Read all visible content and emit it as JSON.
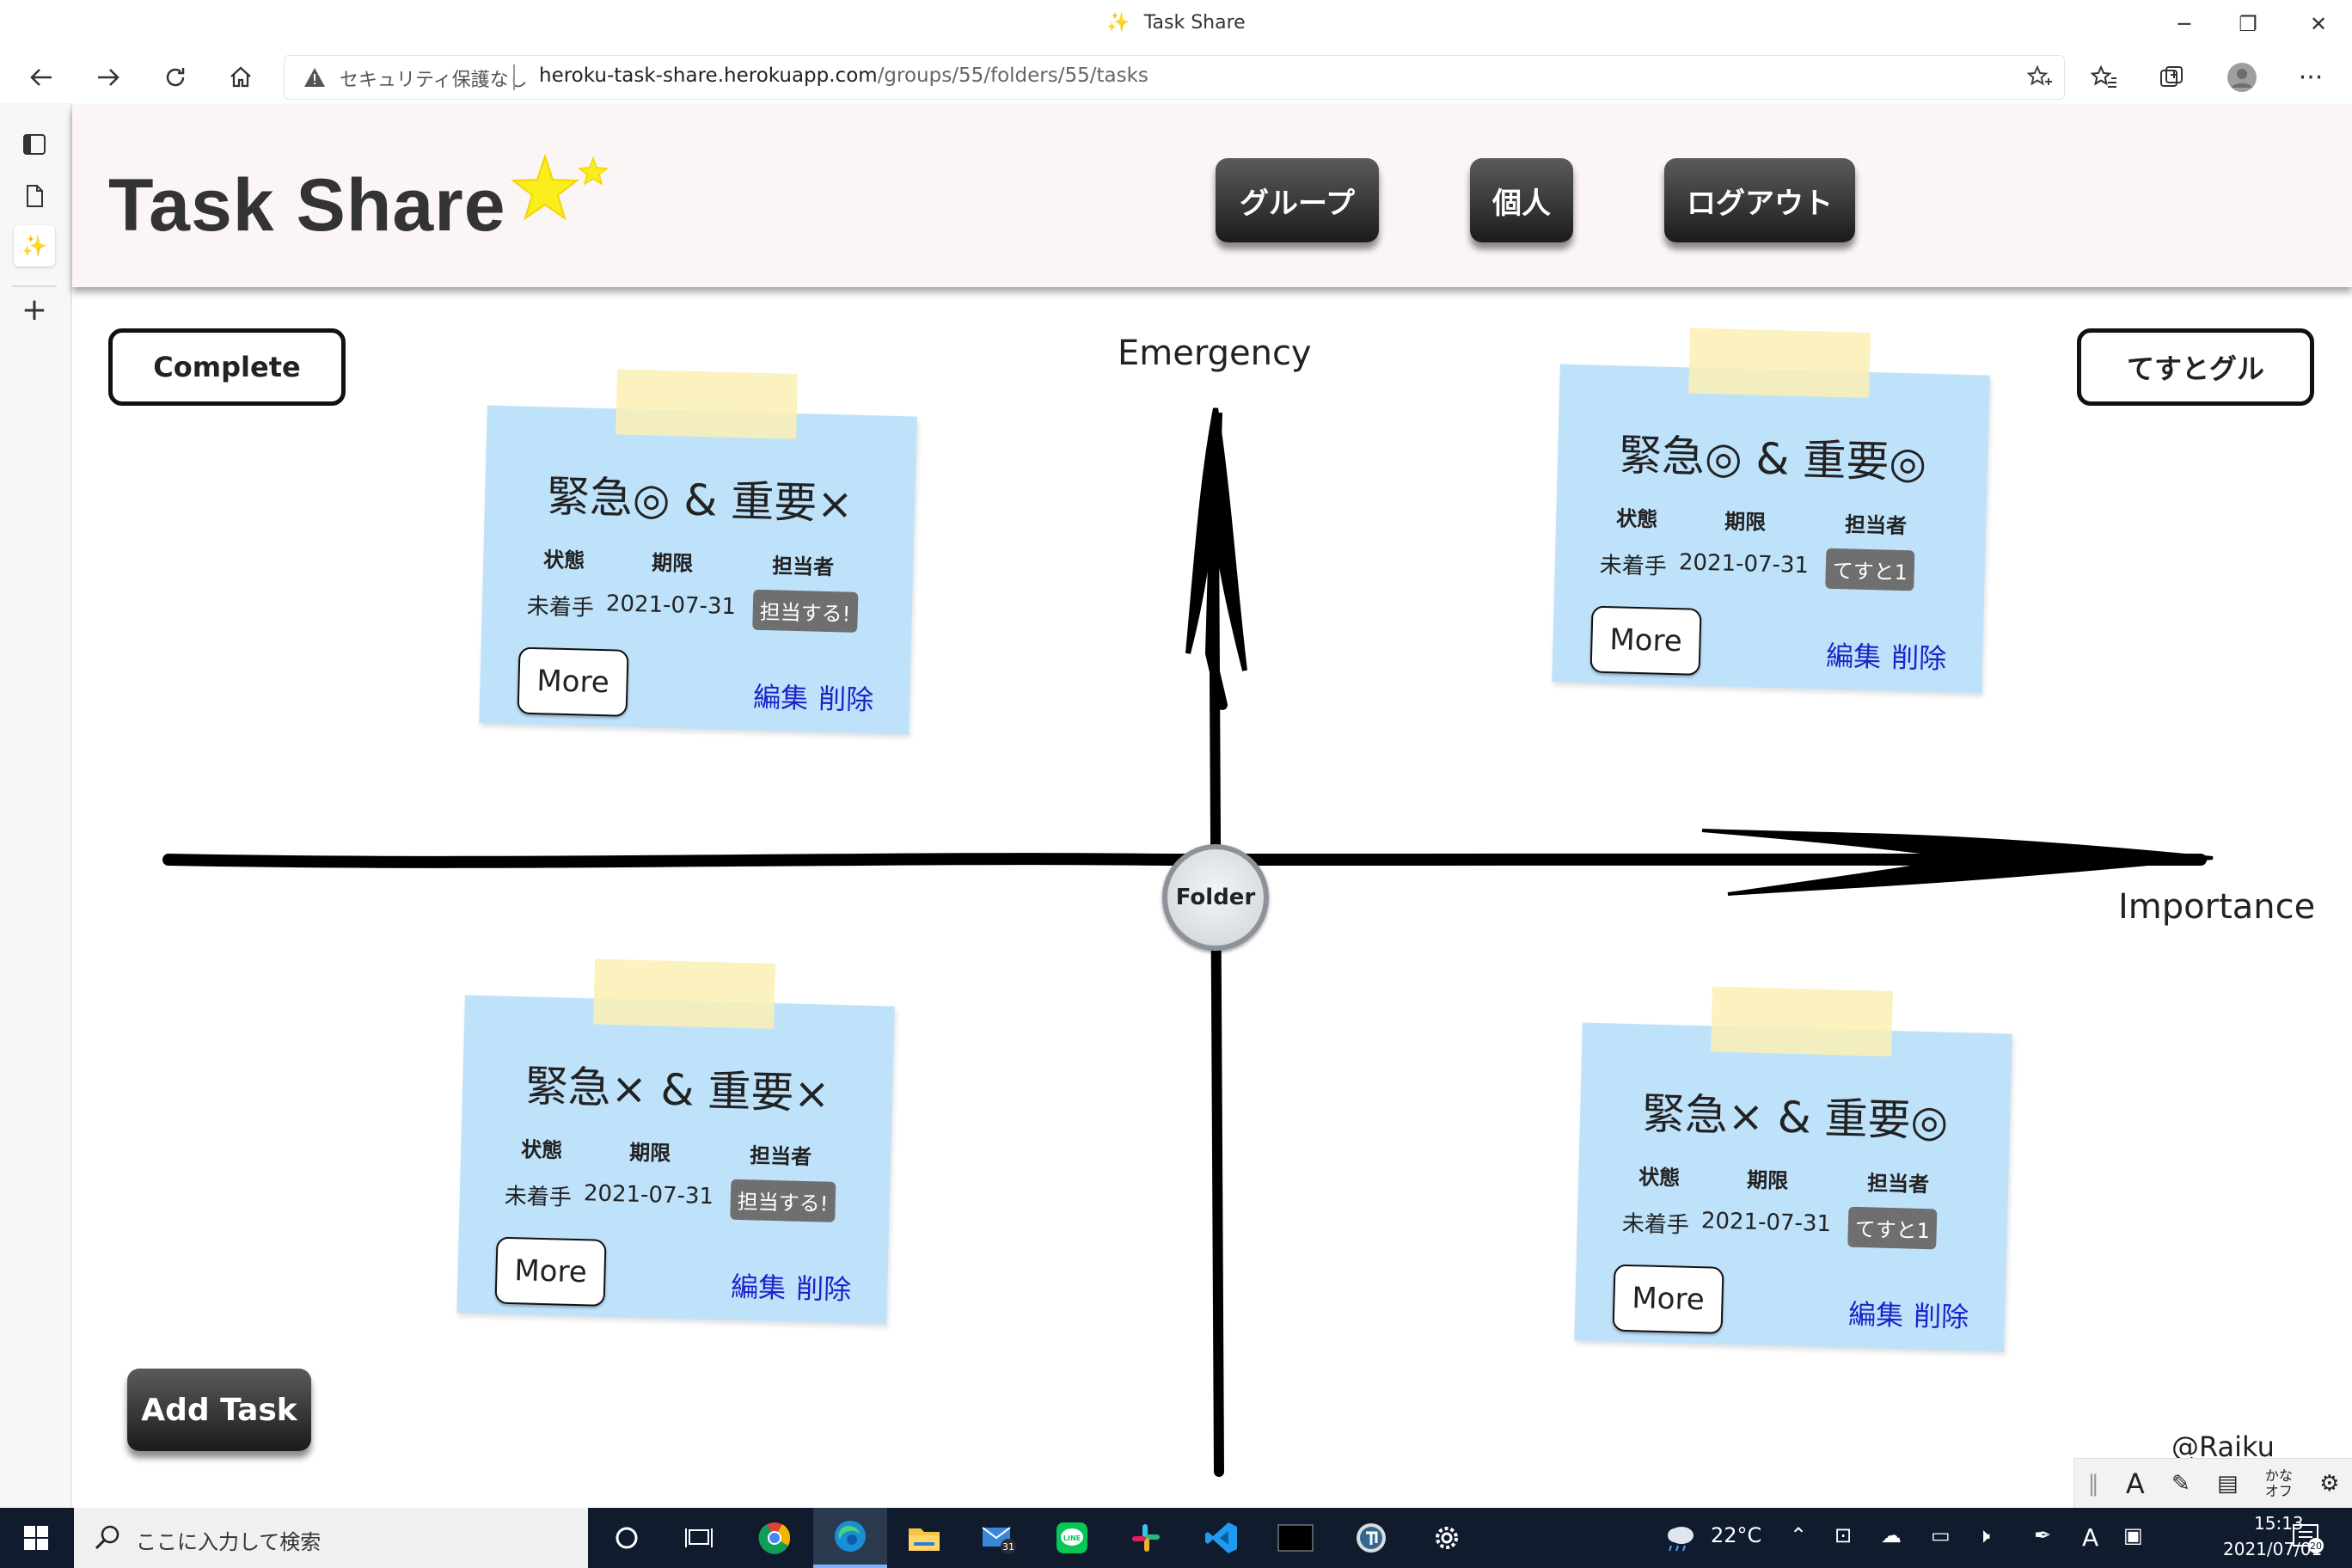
{
  "window": {
    "title": "Task Share"
  },
  "browser": {
    "security_label": "セキュリティ保護なし",
    "url_host": "heroku-task-share.herokuapp.com",
    "url_path": "/groups/55/folders/55/tasks"
  },
  "header": {
    "logo": "Task Share",
    "nav": [
      "グループ",
      "個人",
      "ログアウト"
    ]
  },
  "main": {
    "complete_label": "Complete",
    "group_label": "てすとグル",
    "axis_y_label": "Emergency",
    "axis_x_label": "Importance",
    "folder_label": "Folder",
    "add_task_label": "Add Task",
    "credit": "@Raiku"
  },
  "columns": [
    "状態",
    "期限",
    "担当者"
  ],
  "notes": [
    {
      "title": "緊急◎ & 重要×",
      "status": "未着手",
      "due": "2021-07-31",
      "assignee": "担当する!",
      "more": "More",
      "edit": "編集",
      "delete": "削除"
    },
    {
      "title": "緊急◎ & 重要◎",
      "status": "未着手",
      "due": "2021-07-31",
      "assignee": "てすと1",
      "more": "More",
      "edit": "編集",
      "delete": "削除"
    },
    {
      "title": "緊急× & 重要×",
      "status": "未着手",
      "due": "2021-07-31",
      "assignee": "担当する!",
      "more": "More",
      "edit": "編集",
      "delete": "削除"
    },
    {
      "title": "緊急× & 重要◎",
      "status": "未着手",
      "due": "2021-07-31",
      "assignee": "てすと1",
      "more": "More",
      "edit": "編集",
      "delete": "削除"
    }
  ],
  "ime": {
    "kana_line1": "かな",
    "kana_line2": "オフ",
    "mode": "A"
  },
  "taskbar": {
    "search_placeholder": "ここに入力して検索",
    "mail_badge": "31",
    "weather": "22°C",
    "ime_mode": "A",
    "time": "15:13",
    "date": "2021/07/01",
    "notif_count": "20"
  },
  "colors": {
    "note_bg": "#bfe2fb",
    "tape": "#faf0b4",
    "link": "#1e22c8",
    "header_bg": "#fbf5f5",
    "taskbar": "#101b2e"
  }
}
